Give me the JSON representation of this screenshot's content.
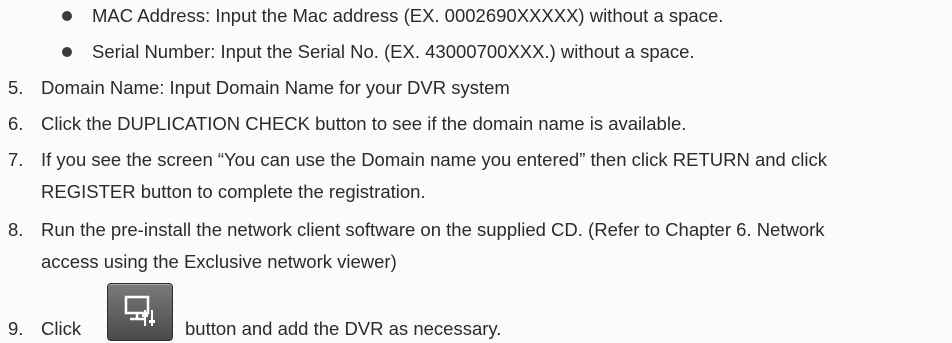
{
  "bullets": [
    "MAC Address: Input the Mac address (EX. 0002690XXXXX) without a space.",
    "Serial Number: Input the Serial No. (EX. 43000700XXX.) without a space."
  ],
  "steps": [
    {
      "num": "5.",
      "lines": [
        "Domain Name: Input Domain Name for your DVR system"
      ]
    },
    {
      "num": "6.",
      "lines": [
        "Click the DUPLICATION CHECK button to see if the domain name is available."
      ]
    },
    {
      "num": "7.",
      "lines": [
        "If you see the screen “You can use the Domain name you entered” then click RETURN and click",
        "REGISTER button to complete the registration."
      ]
    },
    {
      "num": "8.",
      "lines": [
        "Run the pre-install the network client software on the supplied CD. (Refer to Chapter 6. Network",
        "access using the Exclusive network viewer)"
      ]
    },
    {
      "num": "9.",
      "before": "Click",
      "after": "button and add the DVR as necessary."
    }
  ],
  "icon": "network-viewer-settings-icon"
}
